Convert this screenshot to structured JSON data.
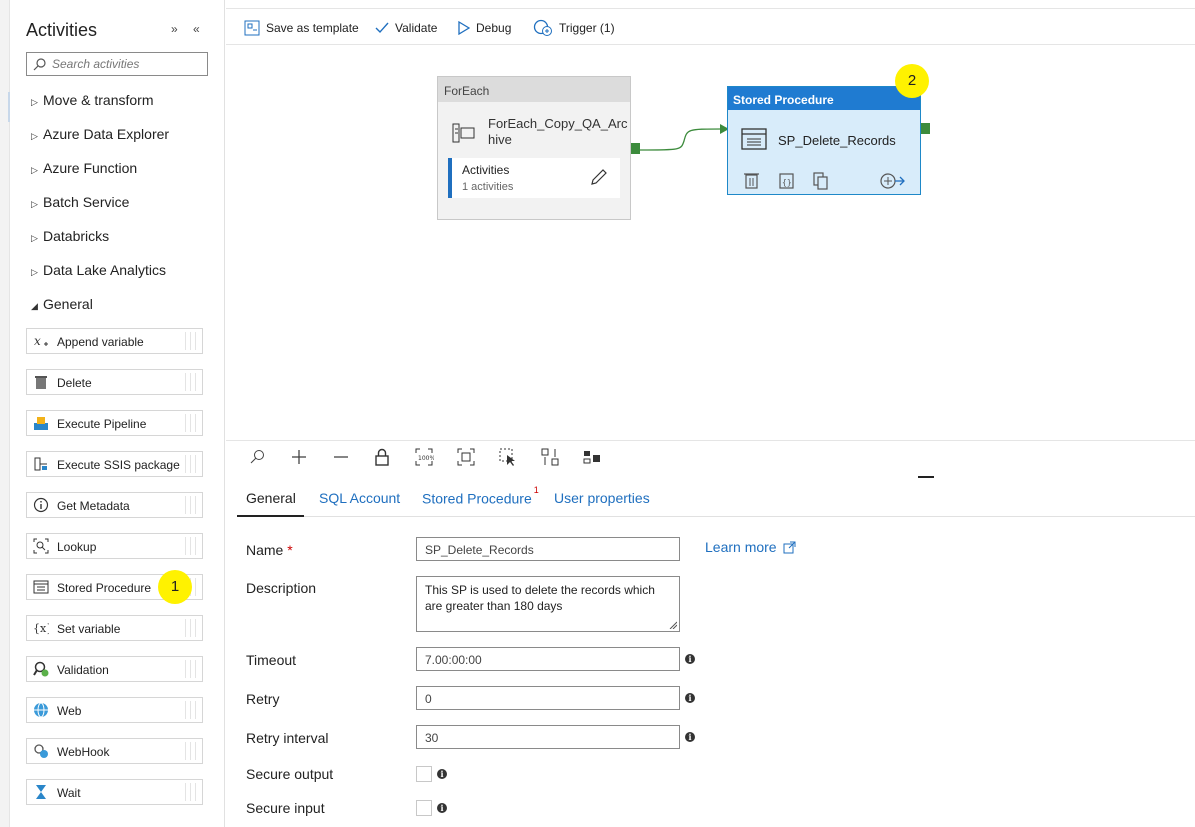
{
  "activities": {
    "title": "Activities",
    "collapse_glyphs": "» «",
    "search_placeholder": "Search activities",
    "categories": [
      {
        "label": "Move & transform",
        "expanded": false
      },
      {
        "label": "Azure Data Explorer",
        "expanded": false
      },
      {
        "label": "Azure Function",
        "expanded": false
      },
      {
        "label": "Batch Service",
        "expanded": false
      },
      {
        "label": "Databricks",
        "expanded": false
      },
      {
        "label": "Data Lake Analytics",
        "expanded": false
      },
      {
        "label": "General",
        "expanded": true
      }
    ],
    "general_items": [
      {
        "label": "Append variable",
        "icon": "append-variable-icon"
      },
      {
        "label": "Delete",
        "icon": "trash-icon"
      },
      {
        "label": "Execute Pipeline",
        "icon": "execute-pipeline-icon"
      },
      {
        "label": "Execute SSIS package",
        "icon": "ssis-icon"
      },
      {
        "label": "Get Metadata",
        "icon": "info-circle-icon"
      },
      {
        "label": "Lookup",
        "icon": "lookup-icon"
      },
      {
        "label": "Stored Procedure",
        "icon": "stored-procedure-icon"
      },
      {
        "label": "Set variable",
        "icon": "set-variable-icon"
      },
      {
        "label": "Validation",
        "icon": "validation-icon"
      },
      {
        "label": "Web",
        "icon": "web-globe-icon"
      },
      {
        "label": "WebHook",
        "icon": "webhook-icon"
      },
      {
        "label": "Wait",
        "icon": "hourglass-icon"
      }
    ]
  },
  "markers": {
    "one": "1",
    "two": "2"
  },
  "toolbar": {
    "save_template": "Save as template",
    "validate": "Validate",
    "debug": "Debug",
    "trigger": "Trigger (1)"
  },
  "canvas": {
    "foreach": {
      "header": "ForEach",
      "name": "ForEach_Copy_QA_Archive",
      "inner_title": "Activities",
      "inner_count": "1 activities"
    },
    "stored_procedure": {
      "header": "Stored Procedure",
      "name": "SP_Delete_Records"
    }
  },
  "tabs": [
    {
      "label": "General",
      "active": true,
      "badge": ""
    },
    {
      "label": "SQL Account",
      "active": false,
      "badge": ""
    },
    {
      "label": "Stored Procedure",
      "active": false,
      "badge": "1"
    },
    {
      "label": "User properties",
      "active": false,
      "badge": ""
    }
  ],
  "form": {
    "name_label": "Name",
    "name_required": "*",
    "name_value": "SP_Delete_Records",
    "learn_more": "Learn more",
    "description_label": "Description",
    "description_value": "This SP is used to delete the records which are greater than 180 days",
    "timeout_label": "Timeout",
    "timeout_value": "7.00:00:00",
    "retry_label": "Retry",
    "retry_value": "0",
    "retry_interval_label": "Retry interval",
    "retry_interval_value": "30",
    "secure_output_label": "Secure output",
    "secure_input_label": "Secure input",
    "info_glyph": "i"
  },
  "colors": {
    "accent": "#1f7bd1",
    "link": "#1f6fbf",
    "marker": "#fff200",
    "port": "#3c8b3c",
    "selected_fill": "#d8ecfa"
  }
}
